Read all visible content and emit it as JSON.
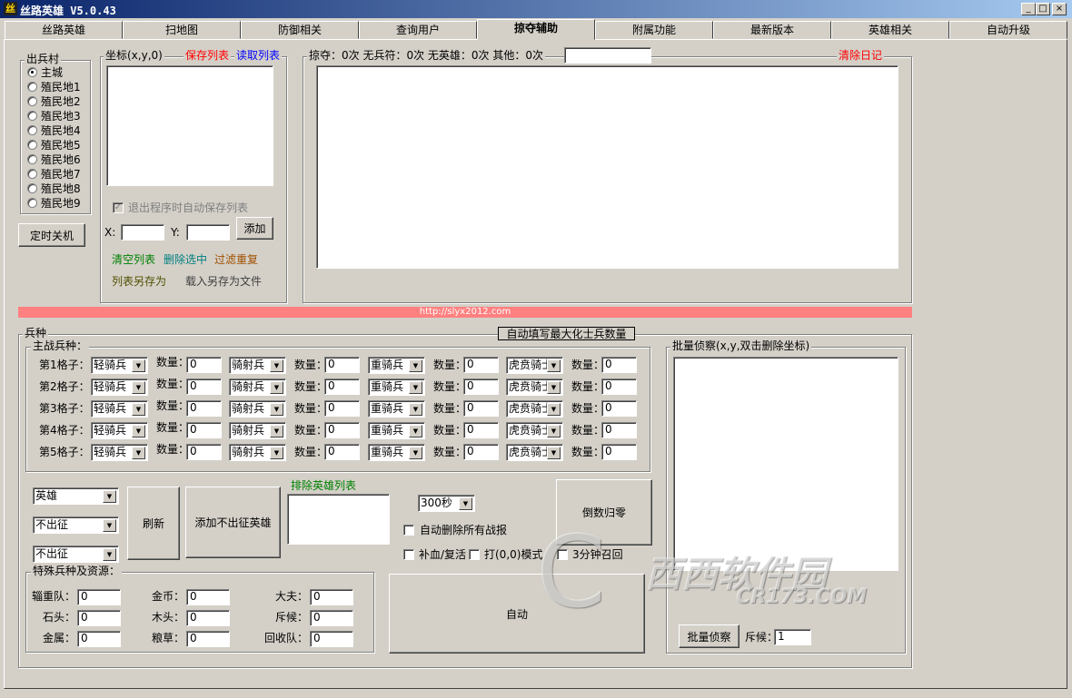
{
  "window": {
    "title": "丝路英雄 V5.0.43",
    "icon_text": "丝",
    "minimize": "_",
    "maximize": "□",
    "close": "×"
  },
  "tabs": [
    {
      "label": "丝路英雄"
    },
    {
      "label": "扫地图"
    },
    {
      "label": "防御相关"
    },
    {
      "label": "查询用户"
    },
    {
      "label": "掠夺辅助",
      "active": true
    },
    {
      "label": "附属功能"
    },
    {
      "label": "最新版本"
    },
    {
      "label": "英雄相关"
    },
    {
      "label": "自动升级"
    }
  ],
  "village": {
    "legend": "出兵村",
    "options": [
      "主城",
      "殖民地1",
      "殖民地2",
      "殖民地3",
      "殖民地4",
      "殖民地5",
      "殖民地6",
      "殖民地7",
      "殖民地8",
      "殖民地9"
    ],
    "selected": 0,
    "shutdown_button": "定时关机"
  },
  "coords": {
    "legend": "坐标(x,y,0)",
    "save_list": "保存列表",
    "read_list": "读取列表",
    "autosave_label": "退出程序时自动保存列表",
    "autosave_checked": true,
    "x_label": "X:",
    "x_value": "",
    "y_label": "Y:",
    "y_value": "",
    "add_button": "添加",
    "clear_list": "清空列表",
    "delete_selected": "删除选中",
    "filter_dup": "过滤重复",
    "save_as": "列表另存为",
    "load_save_as": "载入另存为文件"
  },
  "log": {
    "stats": "掠夺：0次 无兵符：0次 无英雄：0次 其他：0次",
    "input_value": "",
    "clear_log": "清除日记"
  },
  "banner": {
    "url": "http://slyx2012.com"
  },
  "troops": {
    "legend": "兵种",
    "autofill_button": "自动填写最大化士兵数量",
    "main_legend": "主战兵种：",
    "qty_label": "数量：",
    "rows": [
      {
        "label": "第1格子：",
        "slots": [
          {
            "type": "轻骑兵",
            "qty": "0"
          },
          {
            "type": "骑射兵",
            "qty": "0"
          },
          {
            "type": "重骑兵",
            "qty": "0"
          },
          {
            "type": "虎贲骑士",
            "qty": "0"
          }
        ]
      },
      {
        "label": "第2格子：",
        "slots": [
          {
            "type": "轻骑兵",
            "qty": "0"
          },
          {
            "type": "骑射兵",
            "qty": "0"
          },
          {
            "type": "重骑兵",
            "qty": "0"
          },
          {
            "type": "虎贲骑士",
            "qty": "0"
          }
        ]
      },
      {
        "label": "第3格子：",
        "slots": [
          {
            "type": "轻骑兵",
            "qty": "0"
          },
          {
            "type": "骑射兵",
            "qty": "0"
          },
          {
            "type": "重骑兵",
            "qty": "0"
          },
          {
            "type": "虎贲骑士",
            "qty": "0"
          }
        ]
      },
      {
        "label": "第4格子：",
        "slots": [
          {
            "type": "轻骑兵",
            "qty": "0"
          },
          {
            "type": "骑射兵",
            "qty": "0"
          },
          {
            "type": "重骑兵",
            "qty": "0"
          },
          {
            "type": "虎贲骑士",
            "qty": "0"
          }
        ]
      },
      {
        "label": "第5格子：",
        "slots": [
          {
            "type": "轻骑兵",
            "qty": "0"
          },
          {
            "type": "骑射兵",
            "qty": "0"
          },
          {
            "type": "重骑兵",
            "qty": "0"
          },
          {
            "type": "虎贲骑士",
            "qty": "0"
          }
        ]
      }
    ]
  },
  "hero": {
    "select1": "英雄",
    "select2": "不出征",
    "select3": "不出征",
    "refresh_button": "刷新",
    "add_no_march_button": "添加不出征英雄",
    "exclude_label": "排除英雄列表",
    "timer_select": "300秒",
    "auto_delete_reports": "自动删除所有战报",
    "heal_revive": "补血/复活",
    "hit_00_mode": "打(0,0)模式",
    "recall_3min": "3分钟召回",
    "countdown_reset_button": "倒数归零",
    "auto_button": "自动"
  },
  "special": {
    "legend": "特殊兵种及资源：",
    "fields": [
      {
        "label": "辎重队：",
        "value": "0"
      },
      {
        "label": "金币：",
        "value": "0"
      },
      {
        "label": "大夫：",
        "value": "0"
      },
      {
        "label": "石头：",
        "value": "0"
      },
      {
        "label": "木头：",
        "value": "0"
      },
      {
        "label": "斥候：",
        "value": "0"
      },
      {
        "label": "金属：",
        "value": "0"
      },
      {
        "label": "粮草：",
        "value": "0"
      },
      {
        "label": "回收队：",
        "value": "0"
      }
    ]
  },
  "scout": {
    "legend": "批量侦察(x,y,双击删除坐标)",
    "button": "批量侦察",
    "scout_label": "斥候：",
    "scout_value": "1"
  },
  "watermark": {
    "cn": "西西软件园",
    "url": "CR173.COM"
  },
  "colors": {
    "red": "#ff0000",
    "blue": "#0000ff",
    "green": "#008000",
    "teal": "#008080",
    "brown": "#a05000",
    "olive": "#505000",
    "banner": "#ff8080"
  }
}
